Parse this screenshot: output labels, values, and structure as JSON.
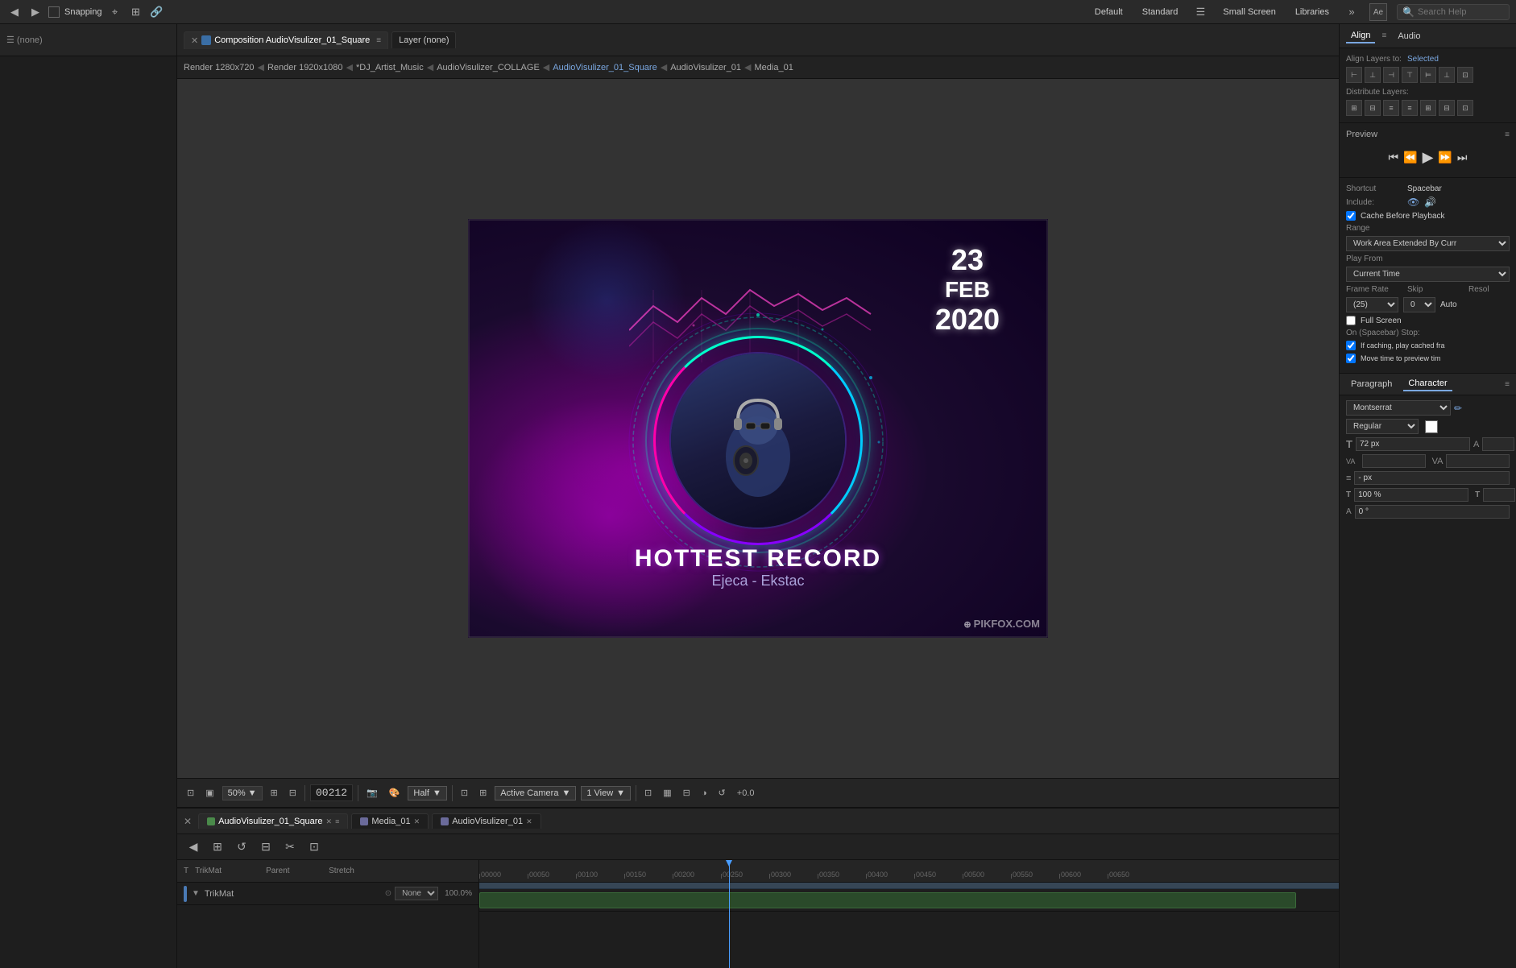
{
  "topbar": {
    "snapping_label": "Snapping",
    "workspace": "Default",
    "standard_label": "Standard",
    "small_screen_label": "Small Screen",
    "libraries_label": "Libraries",
    "search_help_placeholder": "Search Help",
    "search_help_label": "Search Help"
  },
  "tabs": {
    "composition_label": "Composition AudioVisulizer_01_Square",
    "layer_label": "Layer (none)"
  },
  "breadcrumbs": [
    "Render 1280x720",
    "Render 1920x1080",
    "*DJ_Artist_Music",
    "AudioVisulizer_COLLAGE",
    "AudioVisulizer_01_Square",
    "AudioVisulizer_01",
    "Media_01"
  ],
  "composition": {
    "date_day": "23",
    "date_month": "FEB",
    "date_year": "2020",
    "title": "HOTTEST RECORD",
    "artist": "Ejeca - Ekstac",
    "watermark": "PIKFOX.COM"
  },
  "viewer_toolbar": {
    "zoom_label": "50%",
    "timecode": "00212",
    "quality_label": "Half",
    "camera_label": "Active Camera",
    "view_label": "1 View",
    "exposure_label": "+0.0"
  },
  "timeline": {
    "tabs": [
      {
        "label": "AudioVisulizer_01_Square",
        "active": true
      },
      {
        "label": "Media_01",
        "active": false
      },
      {
        "label": "AudioVisulizer_01",
        "active": false
      }
    ],
    "ruler_ticks": [
      "00000",
      "00050",
      "00100",
      "00150",
      "00200",
      "00250",
      "00300",
      "00350",
      "00400",
      "00450",
      "00500",
      "00550",
      "00600",
      "00650"
    ],
    "columns": {
      "t_label": "T",
      "trikmat_label": "TrikMat",
      "parent_label": "Parent",
      "stretch_label": "Stretch"
    },
    "layer": {
      "name": "TrikMat",
      "parent_value": "None",
      "stretch_value": "100.0%"
    }
  },
  "right_panel": {
    "align_title": "Align",
    "audio_title": "Audio",
    "align_to_label": "Align Layers to:",
    "select_label": "Selected",
    "distribute_label": "Distribute Layers:",
    "preview_title": "Preview",
    "shortcut_label": "Shortcut",
    "shortcut_value": "Spacebar",
    "include_label": "Include:",
    "cache_label": "Cache Before Playback",
    "range_label": "Range",
    "range_value": "Work Area Extended By Curr",
    "play_from_label": "Play From",
    "current_time_label": "Current Time",
    "frame_rate_label": "Frame Rate",
    "frame_rate_value": "(25)",
    "skip_label": "Skip",
    "skip_value": "0",
    "resol_label": "Resol",
    "resol_value": "Auto",
    "full_screen_label": "Full Screen",
    "on_stop_label": "On (Spacebar) Stop:",
    "caching_label": "If caching, play cached fra",
    "move_time_label": "Move time to preview tim",
    "paragraph_tab": "Paragraph",
    "character_tab": "Character",
    "font_name": "Montserrat",
    "font_style": "Regular",
    "font_size_label": "T",
    "font_size_value": "72 px",
    "tracking_label": "VA",
    "indent_label": "- px",
    "scale_label": "100 %",
    "rotate_label": "0 °"
  }
}
